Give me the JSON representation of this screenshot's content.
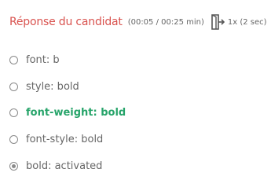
{
  "header": {
    "title": "Réponse du candidat",
    "timer": "(00:05 / 00:25 min)",
    "exit_icon": "exit-door-icon",
    "speed": "1x (2 sec)"
  },
  "options": [
    {
      "label": "font: b",
      "selected": false,
      "correct": false
    },
    {
      "label": "style: bold",
      "selected": false,
      "correct": false
    },
    {
      "label": "font-weight: bold",
      "selected": false,
      "correct": true
    },
    {
      "label": "font-style: bold",
      "selected": false,
      "correct": false
    },
    {
      "label": "bold: activated",
      "selected": true,
      "correct": false
    }
  ],
  "colors": {
    "title": "#d9534f",
    "correct": "#27a46a",
    "text": "#666666"
  }
}
